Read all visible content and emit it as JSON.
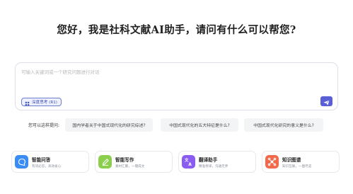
{
  "headline": "您好，我是社科文献AI助手，请问有什么可以帮您?",
  "input": {
    "placeholder": "可输入关键词或一个研究问题进行对话",
    "value": ""
  },
  "deep_think": {
    "label": "深度思考 (R1)",
    "icon": "deep-think-icon",
    "accent": "#6b7fd7"
  },
  "send": {
    "icon": "send-icon",
    "color": "#5a5fd6"
  },
  "suggestions": {
    "label": "您可以这样提问:",
    "items": [
      "国内学者关于中国式现代化的研究综述?",
      "中国式现代化的五大特征是什么?",
      "中国式现代化研究的意义是什么?"
    ]
  },
  "features": [
    {
      "title": "智能问答",
      "subtitle": "有问必答，高效省心",
      "icon": "chat-bubble-icon",
      "color": "#3b8df6"
    },
    {
      "title": "智能写作",
      "subtitle": "素材汇聚，一键成文",
      "icon": "pen-icon",
      "color": "#8ccf4d"
    },
    {
      "title": "翻译助手",
      "subtitle": "精准移译，沟通无界",
      "icon": "translate-icon",
      "color": "#8a5cf0"
    },
    {
      "title": "知识图谱",
      "subtitle": "知识互联，一图尽览",
      "icon": "graph-icon",
      "color": "#f26a4b"
    }
  ]
}
